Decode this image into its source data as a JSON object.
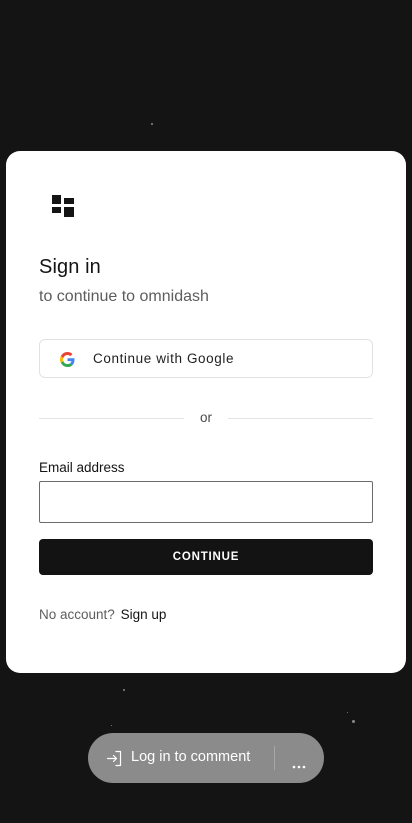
{
  "auth": {
    "title": "Sign in",
    "subtitle": "to continue to omnidash",
    "google_button_label": "Continue with Google",
    "divider_text": "or",
    "email_label": "Email address",
    "email_value": "",
    "email_placeholder": "",
    "continue_label": "CONTINUE",
    "footer_prompt": "No account?",
    "signup_label": "Sign up"
  },
  "comment_bar": {
    "label": "Log in to comment"
  },
  "icons": {
    "logo": "dashboard-logo-icon",
    "google": "google-icon",
    "login": "login-icon",
    "more": "more-horizontal-icon"
  },
  "colors": {
    "background": "#141414",
    "card": "#ffffff",
    "primary_button": "#131313",
    "comment_bar": "#8b8b8b"
  }
}
